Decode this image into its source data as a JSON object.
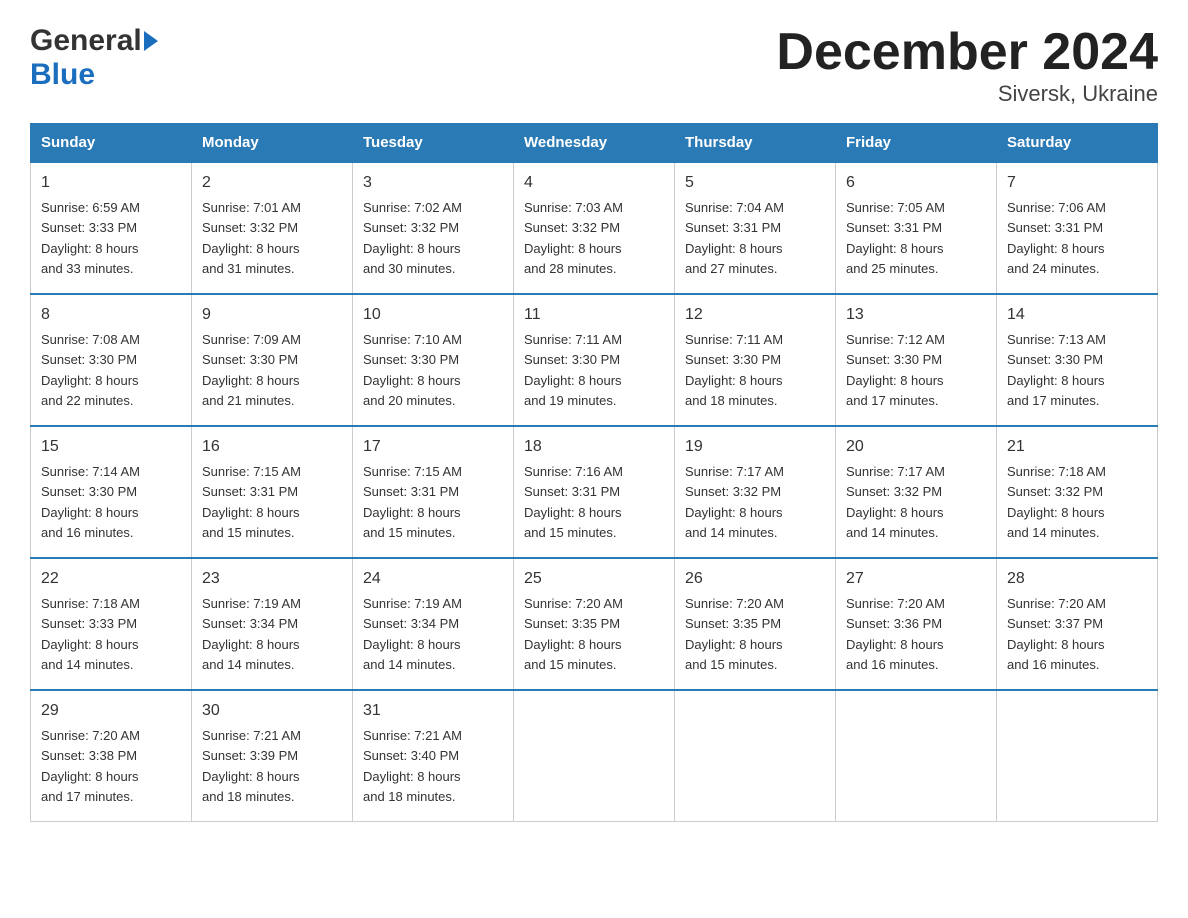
{
  "header": {
    "title": "December 2024",
    "subtitle": "Siversk, Ukraine",
    "logo_general": "General",
    "logo_blue": "Blue"
  },
  "weekdays": [
    "Sunday",
    "Monday",
    "Tuesday",
    "Wednesday",
    "Thursday",
    "Friday",
    "Saturday"
  ],
  "weeks": [
    [
      {
        "day": "1",
        "sunrise": "6:59 AM",
        "sunset": "3:33 PM",
        "daylight": "8 hours and 33 minutes."
      },
      {
        "day": "2",
        "sunrise": "7:01 AM",
        "sunset": "3:32 PM",
        "daylight": "8 hours and 31 minutes."
      },
      {
        "day": "3",
        "sunrise": "7:02 AM",
        "sunset": "3:32 PM",
        "daylight": "8 hours and 30 minutes."
      },
      {
        "day": "4",
        "sunrise": "7:03 AM",
        "sunset": "3:32 PM",
        "daylight": "8 hours and 28 minutes."
      },
      {
        "day": "5",
        "sunrise": "7:04 AM",
        "sunset": "3:31 PM",
        "daylight": "8 hours and 27 minutes."
      },
      {
        "day": "6",
        "sunrise": "7:05 AM",
        "sunset": "3:31 PM",
        "daylight": "8 hours and 25 minutes."
      },
      {
        "day": "7",
        "sunrise": "7:06 AM",
        "sunset": "3:31 PM",
        "daylight": "8 hours and 24 minutes."
      }
    ],
    [
      {
        "day": "8",
        "sunrise": "7:08 AM",
        "sunset": "3:30 PM",
        "daylight": "8 hours and 22 minutes."
      },
      {
        "day": "9",
        "sunrise": "7:09 AM",
        "sunset": "3:30 PM",
        "daylight": "8 hours and 21 minutes."
      },
      {
        "day": "10",
        "sunrise": "7:10 AM",
        "sunset": "3:30 PM",
        "daylight": "8 hours and 20 minutes."
      },
      {
        "day": "11",
        "sunrise": "7:11 AM",
        "sunset": "3:30 PM",
        "daylight": "8 hours and 19 minutes."
      },
      {
        "day": "12",
        "sunrise": "7:11 AM",
        "sunset": "3:30 PM",
        "daylight": "8 hours and 18 minutes."
      },
      {
        "day": "13",
        "sunrise": "7:12 AM",
        "sunset": "3:30 PM",
        "daylight": "8 hours and 17 minutes."
      },
      {
        "day": "14",
        "sunrise": "7:13 AM",
        "sunset": "3:30 PM",
        "daylight": "8 hours and 17 minutes."
      }
    ],
    [
      {
        "day": "15",
        "sunrise": "7:14 AM",
        "sunset": "3:30 PM",
        "daylight": "8 hours and 16 minutes."
      },
      {
        "day": "16",
        "sunrise": "7:15 AM",
        "sunset": "3:31 PM",
        "daylight": "8 hours and 15 minutes."
      },
      {
        "day": "17",
        "sunrise": "7:15 AM",
        "sunset": "3:31 PM",
        "daylight": "8 hours and 15 minutes."
      },
      {
        "day": "18",
        "sunrise": "7:16 AM",
        "sunset": "3:31 PM",
        "daylight": "8 hours and 15 minutes."
      },
      {
        "day": "19",
        "sunrise": "7:17 AM",
        "sunset": "3:32 PM",
        "daylight": "8 hours and 14 minutes."
      },
      {
        "day": "20",
        "sunrise": "7:17 AM",
        "sunset": "3:32 PM",
        "daylight": "8 hours and 14 minutes."
      },
      {
        "day": "21",
        "sunrise": "7:18 AM",
        "sunset": "3:32 PM",
        "daylight": "8 hours and 14 minutes."
      }
    ],
    [
      {
        "day": "22",
        "sunrise": "7:18 AM",
        "sunset": "3:33 PM",
        "daylight": "8 hours and 14 minutes."
      },
      {
        "day": "23",
        "sunrise": "7:19 AM",
        "sunset": "3:34 PM",
        "daylight": "8 hours and 14 minutes."
      },
      {
        "day": "24",
        "sunrise": "7:19 AM",
        "sunset": "3:34 PM",
        "daylight": "8 hours and 14 minutes."
      },
      {
        "day": "25",
        "sunrise": "7:20 AM",
        "sunset": "3:35 PM",
        "daylight": "8 hours and 15 minutes."
      },
      {
        "day": "26",
        "sunrise": "7:20 AM",
        "sunset": "3:35 PM",
        "daylight": "8 hours and 15 minutes."
      },
      {
        "day": "27",
        "sunrise": "7:20 AM",
        "sunset": "3:36 PM",
        "daylight": "8 hours and 16 minutes."
      },
      {
        "day": "28",
        "sunrise": "7:20 AM",
        "sunset": "3:37 PM",
        "daylight": "8 hours and 16 minutes."
      }
    ],
    [
      {
        "day": "29",
        "sunrise": "7:20 AM",
        "sunset": "3:38 PM",
        "daylight": "8 hours and 17 minutes."
      },
      {
        "day": "30",
        "sunrise": "7:21 AM",
        "sunset": "3:39 PM",
        "daylight": "8 hours and 18 minutes."
      },
      {
        "day": "31",
        "sunrise": "7:21 AM",
        "sunset": "3:40 PM",
        "daylight": "8 hours and 18 minutes."
      },
      null,
      null,
      null,
      null
    ]
  ],
  "labels": {
    "sunrise": "Sunrise:",
    "sunset": "Sunset:",
    "daylight": "Daylight:"
  }
}
